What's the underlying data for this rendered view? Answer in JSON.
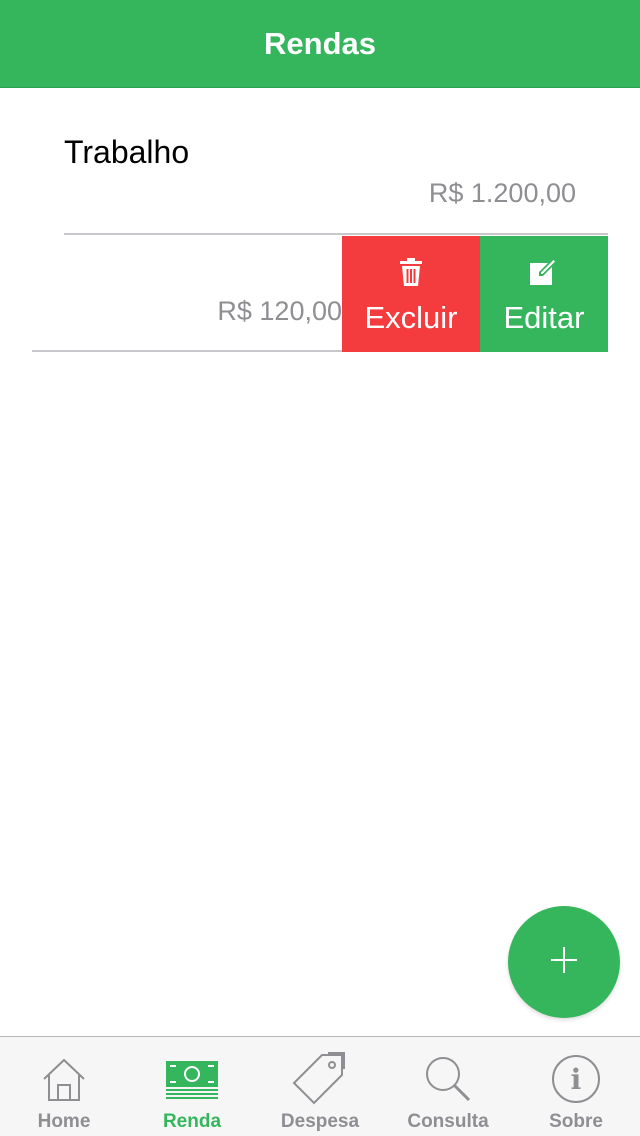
{
  "header": {
    "title": "Rendas"
  },
  "items": [
    {
      "title": "Trabalho",
      "amount": "R$ 1.200,00"
    },
    {
      "title": "",
      "amount": "R$ 120,00"
    }
  ],
  "swipe_actions": {
    "delete_label": "Excluir",
    "edit_label": "Editar"
  },
  "fab": {
    "icon": "plus-icon"
  },
  "tabs": [
    {
      "label": "Home",
      "icon": "home-icon",
      "active": false
    },
    {
      "label": "Renda",
      "icon": "money-icon",
      "active": true
    },
    {
      "label": "Despesa",
      "icon": "tag-icon",
      "active": false
    },
    {
      "label": "Consulta",
      "icon": "search-icon",
      "active": false
    },
    {
      "label": "Sobre",
      "icon": "info-icon",
      "active": false
    }
  ],
  "colors": {
    "accent": "#35b65d",
    "danger": "#f43c3f",
    "muted": "#8e8e93",
    "tab_inactive": "#8e8e93"
  }
}
